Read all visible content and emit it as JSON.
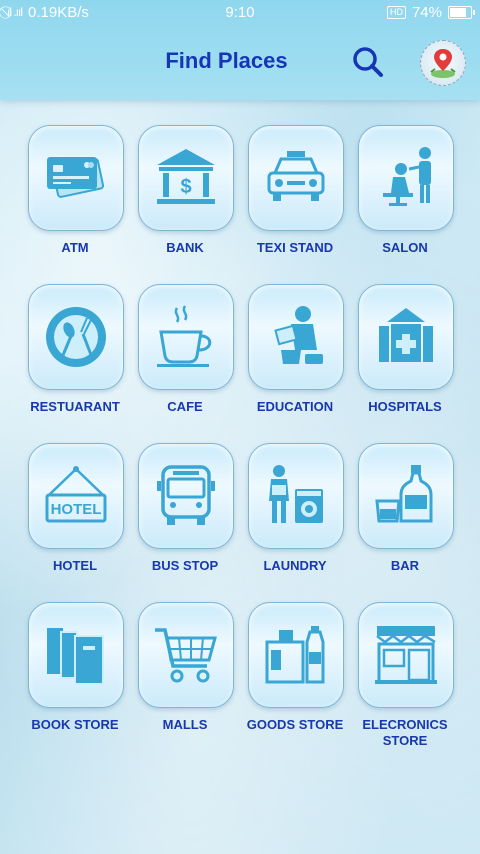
{
  "status_bar": {
    "network": "⃠ıl .ııl",
    "speed": "0.19KB/s",
    "time": "9:10",
    "hd": "HD",
    "battery": "74%"
  },
  "header": {
    "title": "Find Places",
    "search_icon": "search-icon",
    "profile_icon": "location-pin-avatar"
  },
  "colors": {
    "header_bg": "#a6e0f2",
    "title": "#1537b5",
    "label": "#1838ad",
    "icon": "#3aa6d3"
  },
  "categories": [
    {
      "label": "ATM",
      "icon": "credit-card-icon"
    },
    {
      "label": "BANK",
      "icon": "bank-icon"
    },
    {
      "label": "TEXI STAND",
      "icon": "taxi-icon"
    },
    {
      "label": "SALON",
      "icon": "salon-icon"
    },
    {
      "label": "RESTUARANT",
      "icon": "restaurant-icon"
    },
    {
      "label": "CAFE",
      "icon": "coffee-cup-icon"
    },
    {
      "label": "EDUCATION",
      "icon": "reading-person-icon"
    },
    {
      "label": "HOSPITALS",
      "icon": "hospital-icon"
    },
    {
      "label": "HOTEL",
      "icon": "hotel-sign-icon"
    },
    {
      "label": "BUS STOP",
      "icon": "bus-icon"
    },
    {
      "label": "LAUNDRY",
      "icon": "laundry-icon"
    },
    {
      "label": "BAR",
      "icon": "bottle-glass-icon"
    },
    {
      "label": "BOOK STORE",
      "icon": "books-icon"
    },
    {
      "label": "MALLS",
      "icon": "shopping-cart-icon"
    },
    {
      "label": "GOODS STORE",
      "icon": "grocery-icon"
    },
    {
      "label": "ELECRONICS STORE",
      "icon": "storefront-icon"
    }
  ]
}
